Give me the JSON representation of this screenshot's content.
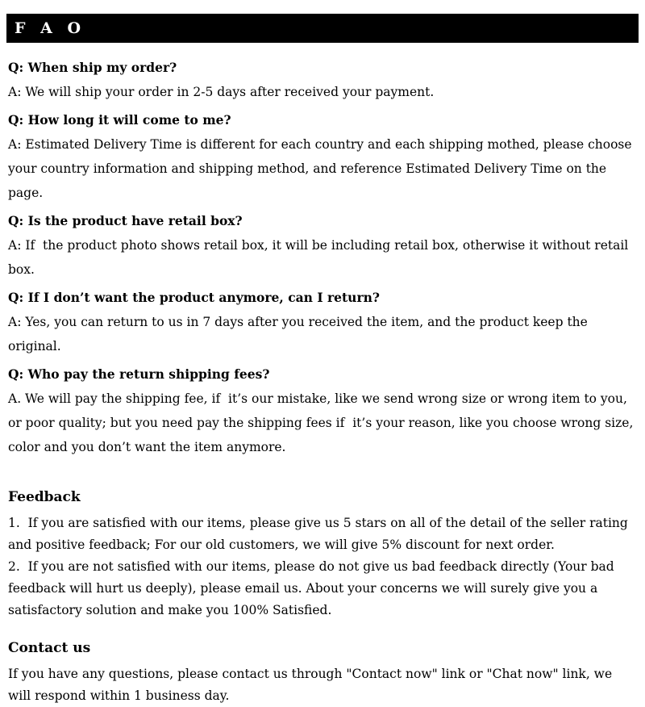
{
  "header": {
    "title": "F A O"
  },
  "faq": {
    "items": [
      {
        "question": "Q: When ship my order?",
        "answer": "A: We will ship your order in 2-5 days after received your payment."
      },
      {
        "question": "Q: How long it will come to me?",
        "answer": "A: Estimated Delivery Time is different for each country and each shipping mothed, please choose your country information and shipping method, and reference Estimated Delivery Time on the page."
      },
      {
        "question": "Q: Is the product have retail box?",
        "answer": "A: If  the product photo shows retail box, it will be including retail box, otherwise it without retail box."
      },
      {
        "question": "Q: If I don’t want the product anymore, can I return?",
        "answer": "A: Yes, you can return to us in 7 days after you received the item, and the product keep the original."
      },
      {
        "question": "Q: Who pay the return shipping fees?",
        "answer": "A. We will pay the shipping fee, if  it’s our mistake, like we send wrong size or wrong item to you, or poor quality; but you need pay the shipping fees if  it’s your reason, like you choose wrong size, color and you don’t want the item anymore."
      }
    ]
  },
  "feedback": {
    "heading": "Feedback",
    "point_1": "1.  If you are satisfied with our items, please give us 5 stars on all of the detail of the seller rating and positive feedback; For our old customers, we will give 5% discount for next order.",
    "point_2": "2.  If you are not satisfied with our items, please do not give us bad feedback directly (Your bad feedback will hurt us deeply), please email us. About your concerns we will surely give you a satisfactory solution and make you 100% Satisfied."
  },
  "contact": {
    "heading": "Contact us",
    "body": "If you have any questions, please contact us through \"Contact now\" link or \"Chat now\" link, we will respond within 1 business day."
  },
  "colors": {
    "bar_background": "#000000",
    "bar_text": "#ffffff",
    "page_background": "#ffffff",
    "body_text": "#000000"
  }
}
